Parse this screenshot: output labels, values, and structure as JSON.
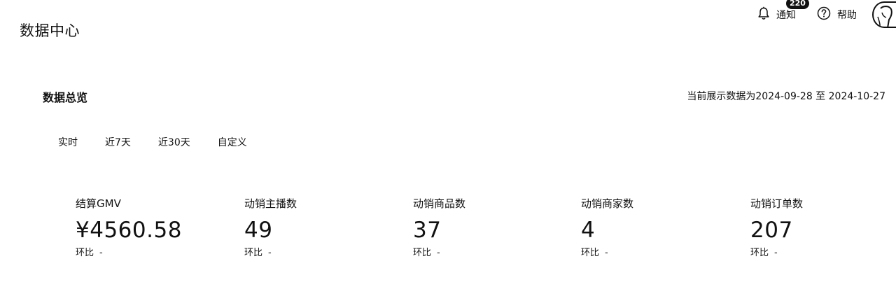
{
  "page": {
    "title": "数据中心"
  },
  "header": {
    "notifications": {
      "label": "通知",
      "count": "220"
    },
    "help": {
      "label": "帮助"
    }
  },
  "overview": {
    "title": "数据总览",
    "date_range": "当前展示数据为2024-09-28 至 2024-10-27",
    "tabs": [
      {
        "label": "实时"
      },
      {
        "label": "近7天"
      },
      {
        "label": "近30天"
      },
      {
        "label": "自定义"
      }
    ],
    "metrics": [
      {
        "label": "结算GMV",
        "value": "¥4560.58",
        "compare_label": "环比",
        "compare_value": "-"
      },
      {
        "label": "动销主播数",
        "value": "49",
        "compare_label": "环比",
        "compare_value": "-"
      },
      {
        "label": "动销商品数",
        "value": "37",
        "compare_label": "环比",
        "compare_value": "-"
      },
      {
        "label": "动销商家数",
        "value": "4",
        "compare_label": "环比",
        "compare_value": "-"
      },
      {
        "label": "动销订单数",
        "value": "207",
        "compare_label": "环比",
        "compare_value": "-"
      }
    ]
  },
  "icons": {
    "notification": "bell-icon",
    "help": "question-circle-icon",
    "avatar": "avatar"
  }
}
